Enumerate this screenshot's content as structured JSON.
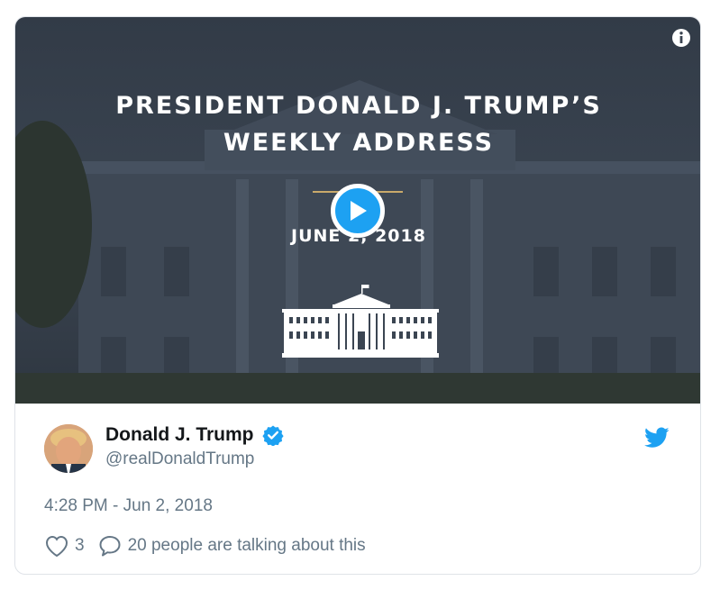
{
  "media": {
    "headline_line1": "PRESIDENT DONALD J. TRUMP’S",
    "headline_line2": "WEEKLY ADDRESS",
    "date": "JUNE 2, 2018",
    "play_icon": "play-icon",
    "info_icon": "info-icon",
    "accent_color": "#1da1f2"
  },
  "author": {
    "display_name": "Donald J. Trump",
    "handle": "@realDonaldTrump",
    "verified_icon": "verified-badge-icon"
  },
  "timestamp": "4:28 PM - Jun 2, 2018",
  "actions": {
    "like_count": "3",
    "talking_text": "20 people are talking about this"
  },
  "brand": {
    "logo": "twitter-bird-icon",
    "color": "#1da1f2"
  }
}
